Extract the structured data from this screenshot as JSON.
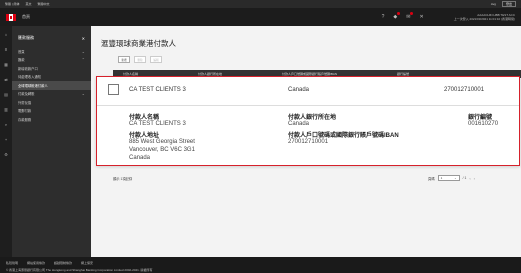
{
  "topbar": {
    "left": [
      "繁體 | 简体",
      "英文",
      "繁體中文"
    ],
    "right": [
      "Avg",
      "登出"
    ]
  },
  "header": {
    "home": "首頁",
    "account_line1": "AAAACHIN HBB TEST ACC",
    "account_line2": "上一次登入 2021/03/2021 11:01:10 (香港時間)"
  },
  "sidebar": {
    "title": "匯款服務",
    "items": [
      {
        "label": "首頁",
        "chevron": "⌄"
      },
      {
        "label": "匯款",
        "chevron": "⌃"
      },
      {
        "label": "新增收款户口",
        "chevron": ""
      },
      {
        "label": "待處理收入通知",
        "chevron": ""
      },
      {
        "label": "全球環球帳港付款人",
        "chevron": ""
      },
      {
        "label": "付款及轉賬",
        "chevron": "⌄"
      },
      {
        "label": "外幣兌換",
        "chevron": ""
      },
      {
        "label": "電郵付款",
        "chevron": ""
      },
      {
        "label": "存款服務",
        "chevron": ""
      }
    ]
  },
  "main": {
    "title": "滙豐環球商業港付款人",
    "toolbar": [
      "新增",
      "刪除",
      "編輯"
    ],
    "table_headers": [
      "付款人名稱",
      "付款人銀行所在地",
      "付款人戶口號碼或國際銀行賬戶號碼IBAN",
      "銀行編號"
    ],
    "record_count": "顯示 1項記錄",
    "pager": {
      "label": "頁碼",
      "page": "1",
      "of": "/ 1"
    }
  },
  "card": {
    "name": "CA TEST CLIENTS 3",
    "country": "Canada",
    "account": "270012710001",
    "label_payer_name": "付款人名稱",
    "payer_name": "CA TEST CLIENTS 3",
    "label_bank_location": "付款人銀行所在地",
    "bank_location": "Canada",
    "label_bank_code": "銀行編號",
    "bank_code": "001610270",
    "label_address": "付款人地址",
    "address_line1": "885 West Georgia Street",
    "address_line2": "Vancouver, BC V6C 3G1",
    "address_line3": "Canada",
    "label_account": "付款人戶口號碼或國際銀行賬戶號碼IBAN",
    "account_detail": "270012710001"
  },
  "footer": {
    "links": [
      "私隱聲明",
      "網站使用條款",
      "超越限制條款",
      "網上保安"
    ],
    "copyright": "© 香港上海滙豐銀行有限公司 The Hongkong and Shanghai Banking Corporation Limited 2002-2021. 版權所有"
  },
  "colors": {
    "brand_red": "#db0011",
    "highlight_border": "#d6212b",
    "dark_header": "#1c1c1c"
  }
}
